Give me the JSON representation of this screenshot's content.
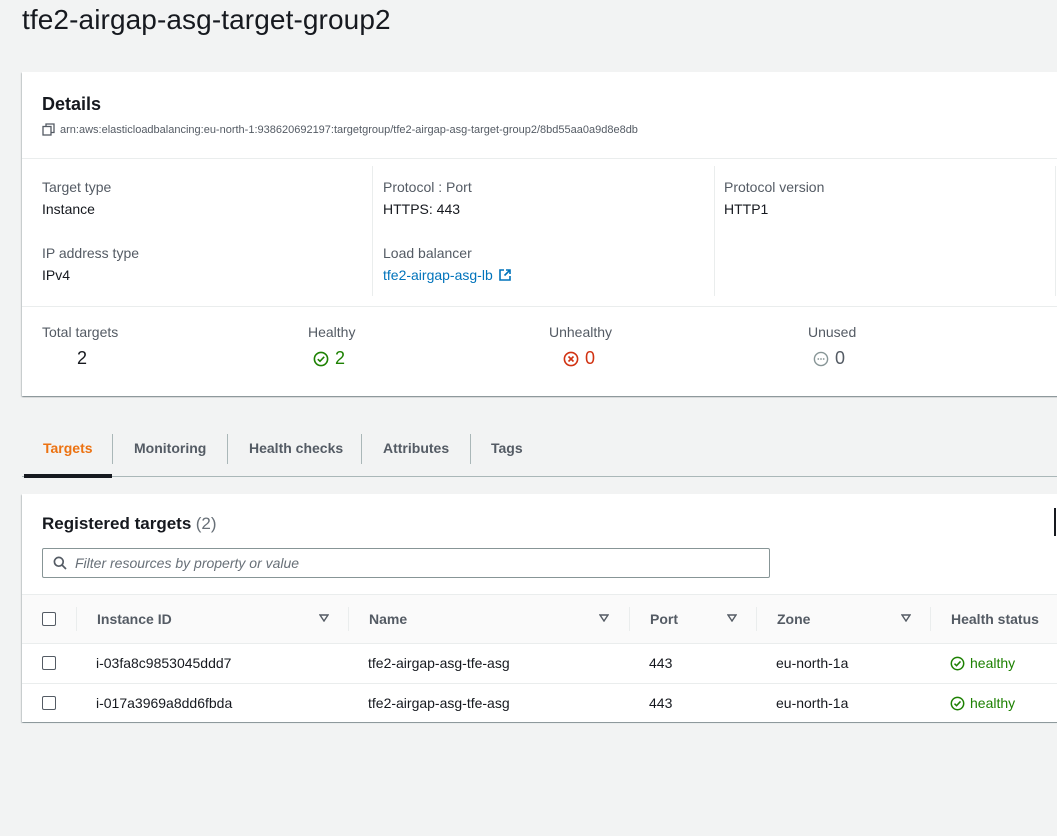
{
  "page": {
    "title": "tfe2-airgap-asg-target-group2"
  },
  "details": {
    "heading": "Details",
    "arn": "arn:aws:elasticloadbalancing:eu-north-1:938620692197:targetgroup/tfe2-airgap-asg-target-group2/8bd55aa0a9d8e8db",
    "target_type_label": "Target type",
    "target_type_value": "Instance",
    "ip_type_label": "IP address type",
    "ip_type_value": "IPv4",
    "protocol_label": "Protocol : Port",
    "protocol_value": "HTTPS: 443",
    "lb_label": "Load balancer",
    "lb_value": "tfe2-airgap-asg-lb",
    "protocol_version_label": "Protocol version",
    "protocol_version_value": "HTTP1"
  },
  "stats": {
    "total_label": "Total targets",
    "total_value": "2",
    "healthy_label": "Healthy",
    "healthy_value": "2",
    "unhealthy_label": "Unhealthy",
    "unhealthy_value": "0",
    "unused_label": "Unused",
    "unused_value": "0"
  },
  "tabs": [
    "Targets",
    "Monitoring",
    "Health checks",
    "Attributes",
    "Tags"
  ],
  "targets": {
    "heading": "Registered targets",
    "count": "(2)",
    "search_placeholder": "Filter resources by property or value",
    "columns": [
      "Instance ID",
      "Name",
      "Port",
      "Zone",
      "Health status"
    ],
    "rows": [
      {
        "instance_id": "i-03fa8c9853045ddd7",
        "name": "tfe2-airgap-asg-tfe-asg",
        "port": "443",
        "zone": "eu-north-1a",
        "health": "healthy"
      },
      {
        "instance_id": "i-017a3969a8dd6fbda",
        "name": "tfe2-airgap-asg-tfe-asg",
        "port": "443",
        "zone": "eu-north-1a",
        "health": "healthy"
      }
    ]
  },
  "colors": {
    "accent": "#ec7211",
    "link": "#0073bb",
    "healthy": "#1d8102",
    "unhealthy": "#d13212",
    "unused": "#879596"
  },
  "icons": [
    "copy-icon",
    "external-link-icon",
    "check-circle-icon",
    "x-circle-icon",
    "dots-circle-icon",
    "search-icon",
    "sort-caret-icon"
  ]
}
